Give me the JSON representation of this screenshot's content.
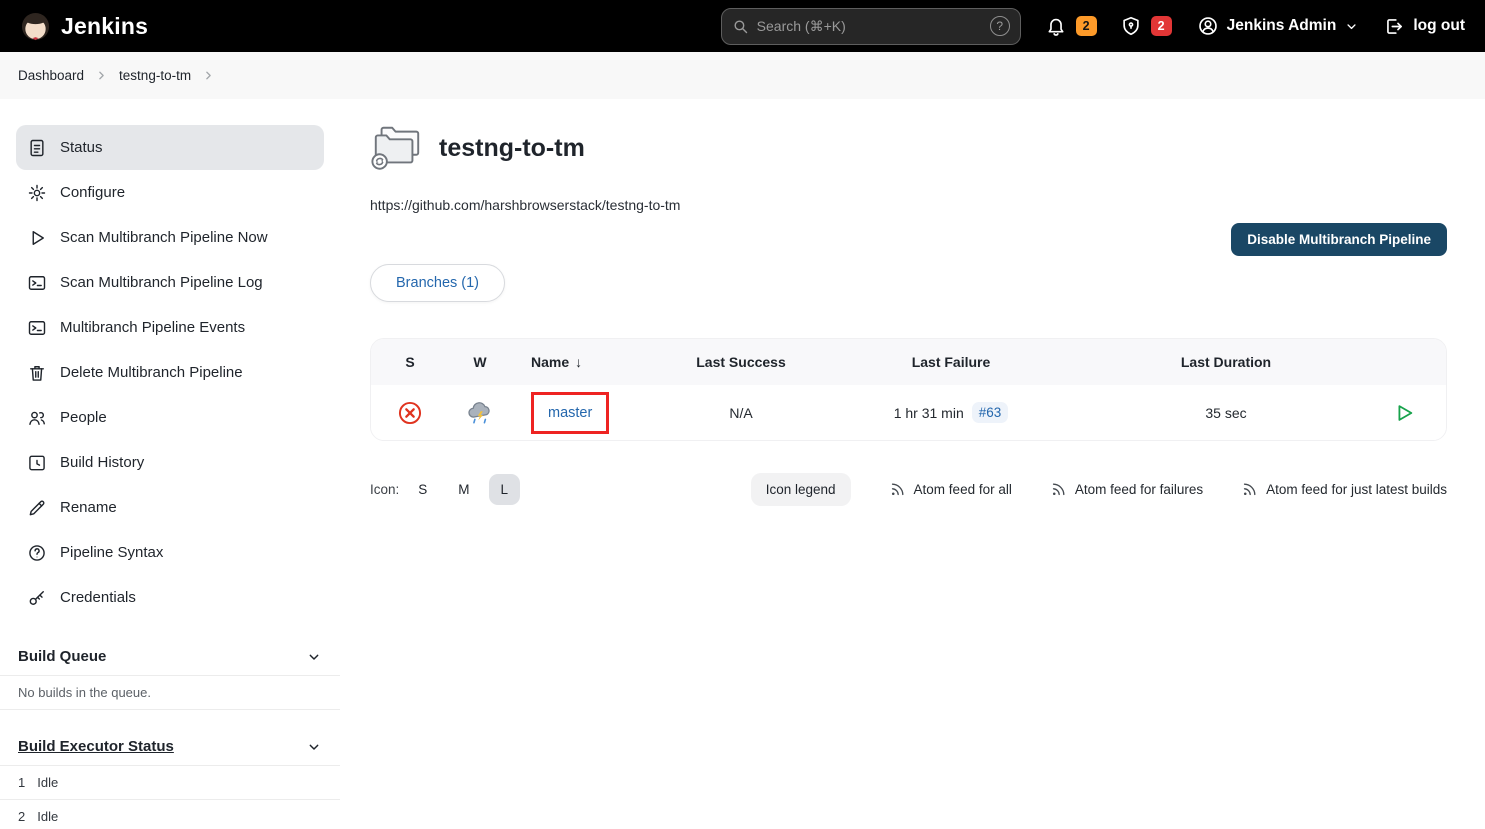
{
  "header": {
    "brand": "Jenkins",
    "search_placeholder": "Search (⌘+K)",
    "help_glyph": "?",
    "notifications_badge": "2",
    "security_badge": "2",
    "user_name": "Jenkins Admin",
    "logout_label": "log out"
  },
  "breadcrumb": {
    "items": [
      {
        "label": "Dashboard"
      },
      {
        "label": "testng-to-tm"
      }
    ]
  },
  "sidebar": {
    "items": [
      {
        "label": "Status"
      },
      {
        "label": "Configure"
      },
      {
        "label": "Scan Multibranch Pipeline Now"
      },
      {
        "label": "Scan Multibranch Pipeline Log"
      },
      {
        "label": "Multibranch Pipeline Events"
      },
      {
        "label": "Delete Multibranch Pipeline"
      },
      {
        "label": "People"
      },
      {
        "label": "Build History"
      },
      {
        "label": "Rename"
      },
      {
        "label": "Pipeline Syntax"
      },
      {
        "label": "Credentials"
      }
    ],
    "build_queue": {
      "title": "Build Queue",
      "empty_message": "No builds in the queue."
    },
    "build_executor_status": {
      "title": "Build Executor Status",
      "executors": [
        {
          "number": "1",
          "state": "Idle"
        },
        {
          "number": "2",
          "state": "Idle"
        }
      ]
    }
  },
  "main": {
    "title": "testng-to-tm",
    "repo_url": "https://github.com/harshbrowserstack/testng-to-tm",
    "disable_button_label": "Disable Multibranch Pipeline",
    "branches_tab_label": "Branches (1)",
    "table": {
      "headers": {
        "s": "S",
        "w": "W",
        "name": "Name",
        "sort_arrow": "↓",
        "last_success": "Last Success",
        "last_failure": "Last Failure",
        "last_duration": "Last Duration"
      },
      "row": {
        "name": "master",
        "last_success": "N/A",
        "last_failure_time": "1 hr 31 min",
        "last_failure_build": "#63",
        "last_duration": "35 sec"
      }
    },
    "icon_size": {
      "label": "Icon:",
      "small": "S",
      "medium": "M",
      "large": "L"
    },
    "legend_row": {
      "icon_legend_label": "Icon legend",
      "feed_all": "Atom feed for all",
      "feed_failures": "Atom feed for failures",
      "feed_latest": "Atom feed for just latest builds"
    }
  },
  "colors": {
    "link_blue": "#2467ad",
    "btn_navy": "#1a4765",
    "fail_red": "#e0331f",
    "annot_red": "#ee2322",
    "badge_orange": "#fd9a29",
    "badge_red": "#e23636",
    "green": "#18a34c"
  }
}
